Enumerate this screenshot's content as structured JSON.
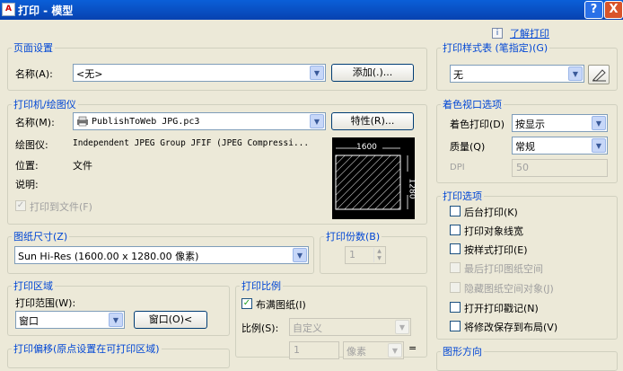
{
  "window": {
    "title": "打印 - 模型",
    "help_label": "?",
    "close_label": "X",
    "app_icon_label": "A"
  },
  "help_link": {
    "info_glyph": "i",
    "label": "了解打印"
  },
  "page_setup": {
    "legend": "页面设置",
    "name_label": "名称(A):",
    "name_value": "<无>",
    "add_button": "添加(.)..."
  },
  "plotter": {
    "legend": "打印机/绘图仪",
    "name_label": "名称(M):",
    "name_value": "PublishToWeb JPG.pc3",
    "properties_button": "特性(R)...",
    "plotter_label": "绘图仪:",
    "plotter_value": "Independent JPEG Group JFIF (JPEG Compressi...",
    "location_label": "位置:",
    "location_value": "文件",
    "description_label": "说明:",
    "plot_to_file_label": "打印到文件(F)",
    "plot_to_file_checked": true,
    "preview_width": "1600",
    "preview_height": "1280"
  },
  "paper_size": {
    "legend": "图纸尺寸(Z)",
    "value": "Sun Hi-Res (1600.00 x 1280.00 像素)"
  },
  "copies": {
    "legend": "打印份数(B)",
    "value": "1"
  },
  "plot_area": {
    "legend": "打印区域",
    "range_label": "打印范围(W):",
    "range_value": "窗口",
    "window_button": "窗口(O)<"
  },
  "plot_scale": {
    "legend": "打印比例",
    "fit_label": "布满图纸(I)",
    "fit_checked": true,
    "scale_label": "比例(S):",
    "scale_value": "自定义",
    "scale_number": "1",
    "scale_unit": "像素",
    "equals": "="
  },
  "plot_offset": {
    "legend": "打印偏移(原点设置在可打印区域)"
  },
  "plot_style_table": {
    "legend": "打印样式表 (笔指定)(G)",
    "value": "无"
  },
  "shaded_viewport": {
    "legend": "着色视口选项",
    "shade_label": "着色打印(D)",
    "shade_value": "按显示",
    "quality_label": "质量(Q)",
    "quality_value": "常规",
    "dpi_label": "DPI",
    "dpi_value": "50"
  },
  "plot_options": {
    "legend": "打印选项",
    "items": [
      {
        "label": "后台打印(K)",
        "checked": false,
        "enabled": true
      },
      {
        "label": "打印对象线宽",
        "checked": false,
        "enabled": true
      },
      {
        "label": "按样式打印(E)",
        "checked": false,
        "enabled": true
      },
      {
        "label": "最后打印图纸空间",
        "checked": false,
        "enabled": false
      },
      {
        "label": "隐藏图纸空间对象(J)",
        "checked": false,
        "enabled": false
      },
      {
        "label": "打开打印戳记(N)",
        "checked": false,
        "enabled": true
      },
      {
        "label": "将修改保存到布局(V)",
        "checked": false,
        "enabled": true
      }
    ]
  },
  "drawing_orientation": {
    "legend": "图形方向"
  },
  "colors": {
    "titlebar": "#0a5fd8",
    "legend": "#0046d5",
    "check": "#21a121"
  },
  "icons": {
    "plotter": "printer-icon",
    "style_edit": "edit-pen-icon",
    "info": "info-icon"
  }
}
